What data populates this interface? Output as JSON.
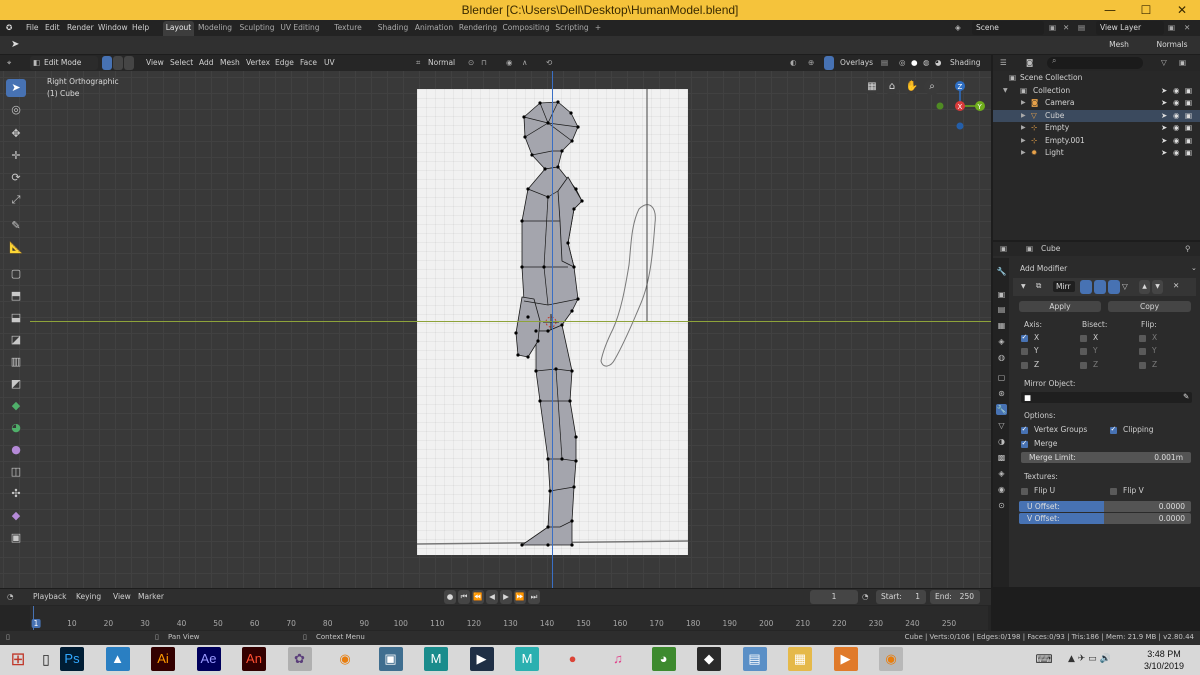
{
  "window": {
    "title": "Blender [C:\\Users\\Dell\\Desktop\\HumanModel.blend]",
    "minimize": "—",
    "maximize": "☐",
    "close": "✕"
  },
  "menu": [
    "File",
    "Edit",
    "Render",
    "Window",
    "Help"
  ],
  "workspaces": [
    "Layout",
    "Modeling",
    "Sculpting",
    "UV Editing",
    "Texture Paint",
    "Shading",
    "Animation",
    "Rendering",
    "Compositing",
    "Scripting",
    "+"
  ],
  "scene": {
    "label": "Scene",
    "view_layer": "View Layer"
  },
  "tool_options": {
    "mesh_options": "Mesh Options",
    "normals": "Normals"
  },
  "viewport_header": {
    "mode": "Edit Mode",
    "menus": [
      "View",
      "Select",
      "Add",
      "Mesh",
      "Vertex",
      "Edge",
      "Face",
      "UV"
    ],
    "orientation": "Normal",
    "overlays": "Overlays",
    "shading": "Shading"
  },
  "viewport": {
    "view_name": "Right Orthographic",
    "object_name": "(1) Cube"
  },
  "outliner": {
    "root": "Scene Collection",
    "collection": "Collection",
    "items": [
      {
        "name": "Camera",
        "icon": "camera-icon",
        "color": "#e8a24a"
      },
      {
        "name": "Cube",
        "icon": "mesh-icon",
        "color": "#e8a24a"
      },
      {
        "name": "Empty",
        "icon": "empty-icon",
        "color": "#e8a24a"
      },
      {
        "name": "Empty.001",
        "icon": "empty-icon",
        "color": "#e8a24a"
      },
      {
        "name": "Light",
        "icon": "light-icon",
        "color": "#e8a24a"
      }
    ]
  },
  "properties": {
    "object_name": "Cube",
    "add_modifier": "Add Modifier",
    "modifier_name": "Mirr",
    "apply": "Apply",
    "copy": "Copy",
    "axis_label": "Axis:",
    "bisect_label": "Bisect:",
    "flip_label": "Flip:",
    "axes": [
      "X",
      "Y",
      "Z"
    ],
    "axis_checked": [
      true,
      false,
      false
    ],
    "mirror_object_label": "Mirror Object:",
    "options_label": "Options:",
    "vertex_groups": "Vertex Groups",
    "clipping": "Clipping",
    "merge": "Merge",
    "merge_limit_label": "Merge Limit:",
    "merge_limit_value": "0.001m",
    "textures_label": "Textures:",
    "flip_u": "Flip U",
    "flip_v": "Flip V",
    "u_offset_label": "U Offset:",
    "u_offset_value": "0.0000",
    "v_offset_label": "V Offset:",
    "v_offset_value": "0.0000"
  },
  "timeline": {
    "menus": [
      "Playback",
      "Keying",
      "View",
      "Marker"
    ],
    "current_frame": "1",
    "start_label": "Start:",
    "start": "1",
    "end_label": "End:",
    "end": "250",
    "ticks": [
      "1",
      "10",
      "20",
      "30",
      "40",
      "50",
      "60",
      "70",
      "80",
      "90",
      "100",
      "110",
      "120",
      "130",
      "140",
      "150",
      "160",
      "170",
      "180",
      "190",
      "200",
      "210",
      "220",
      "230",
      "240",
      "250"
    ]
  },
  "statusbar": {
    "left1": "Pan View",
    "left2": "Context Menu",
    "stats": "Cube | Verts:0/106 | Edges:0/198 | Faces:0/93 | Tris:186 | Mem: 21.9 MB | v2.80.44"
  },
  "taskbar": {
    "apps": [
      {
        "label": "Ps",
        "color": "#001d34",
        "fg": "#31a8ff",
        "name": "photoshop-icon"
      },
      {
        "label": "▲",
        "color": "#2a7fc2",
        "fg": "#ffffff",
        "name": "autodesk-icon"
      },
      {
        "label": "Ai",
        "color": "#330000",
        "fg": "#ff9a00",
        "name": "illustrator-icon"
      },
      {
        "label": "Ae",
        "color": "#00005b",
        "fg": "#9999ff",
        "name": "after-effects-icon"
      },
      {
        "label": "An",
        "color": "#330000",
        "fg": "#ff4f32",
        "name": "animate-icon"
      },
      {
        "label": "✿",
        "color": "#b0b0b0",
        "fg": "#5a3e7a",
        "name": "paint-icon"
      },
      {
        "label": "◉",
        "color": "#d8d8d8",
        "fg": "#e87d0d",
        "name": "blender-icon"
      },
      {
        "label": "▣",
        "color": "#3f6e8f",
        "fg": "#ffffff",
        "name": "window-app-icon"
      },
      {
        "label": "M",
        "color": "#1a8c8c",
        "fg": "#ffffff",
        "name": "maya-icon"
      },
      {
        "label": "▶",
        "color": "#1f2f45",
        "fg": "#ffffff",
        "name": "video-icon"
      },
      {
        "label": "M",
        "color": "#2bb0b0",
        "fg": "#ffffff",
        "name": "maya-lt-icon"
      },
      {
        "label": "●",
        "color": "#d8d8d8",
        "fg": "#db4437",
        "name": "chrome-icon"
      },
      {
        "label": "♫",
        "color": "#d8d8d8",
        "fg": "#e0408a",
        "name": "itunes-icon"
      },
      {
        "label": "◕",
        "color": "#3d8a2e",
        "fg": "#ffffff",
        "name": "sketchup-icon"
      },
      {
        "label": "◆",
        "color": "#2a2a2a",
        "fg": "#ffffff",
        "name": "unity-icon"
      },
      {
        "label": "▤",
        "color": "#5a8fc6",
        "fg": "#ffffff",
        "name": "image-icon"
      },
      {
        "label": "▦",
        "color": "#e5b94a",
        "fg": "#ffffff",
        "name": "folder-icon"
      },
      {
        "label": "▶",
        "color": "#e07a2a",
        "fg": "#ffffff",
        "name": "media-player-icon"
      },
      {
        "label": "◉",
        "color": "#b8b8b8",
        "fg": "#e87d0d",
        "name": "blender-active-icon"
      }
    ],
    "time": "3:48 PM",
    "date": "3/10/2019"
  }
}
